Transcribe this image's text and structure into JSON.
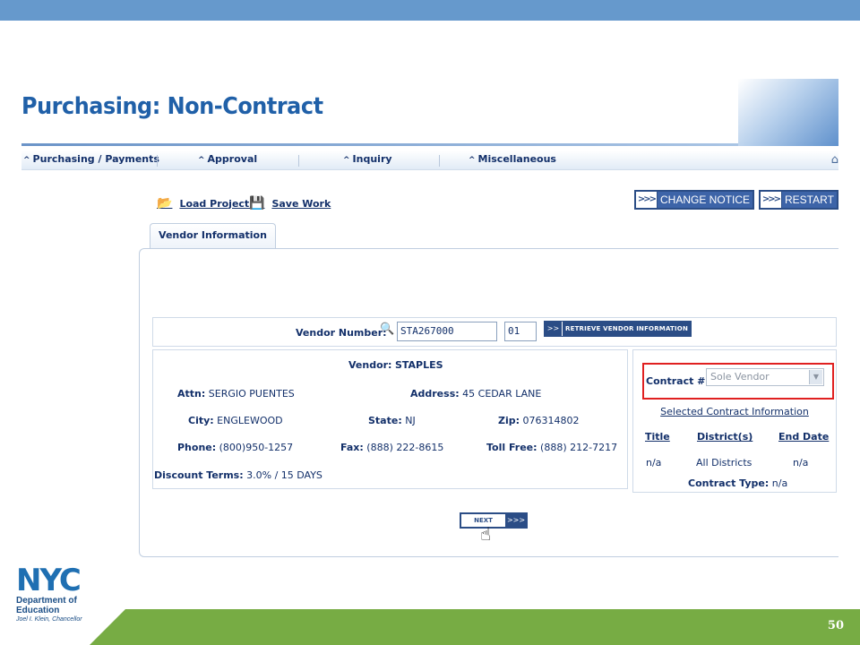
{
  "slide": {
    "title": "Purchasing: Non-Contract",
    "page_number": "50"
  },
  "menu": {
    "items": [
      {
        "label": "Purchasing / Payments"
      },
      {
        "label": "Approval"
      },
      {
        "label": "Inquiry"
      },
      {
        "label": "Miscellaneous"
      }
    ]
  },
  "actions": {
    "load_project": "Load Project",
    "save_work": "Save Work"
  },
  "buttons": {
    "change_notice": "CHANGE NOTICE",
    "restart": "RESTART",
    "retrieve_vendor": "RETRIEVE VENDOR INFORMATION",
    "next": "NEXT"
  },
  "tab": {
    "label": "Vendor Information"
  },
  "vendor_lookup": {
    "label": "Vendor Number:",
    "vendor_number": "STA267000",
    "suffix": "01"
  },
  "vendor": {
    "name_label": "Vendor:",
    "name": "STAPLES",
    "attn_label": "Attn:",
    "attn": "SERGIO PUENTES",
    "address_label": "Address:",
    "address": "45 CEDAR LANE",
    "city_label": "City:",
    "city": "ENGLEWOOD",
    "state_label": "State:",
    "state": "NJ",
    "zip_label": "Zip:",
    "zip": "076314802",
    "phone_label": "Phone:",
    "phone": "(800)950-1257",
    "fax_label": "Fax:",
    "fax": "(888) 222-8615",
    "tollfree_label": "Toll Free:",
    "tollfree": "(888) 212-7217",
    "discount_label": "Discount Terms:",
    "discount": "3.0% / 15 DAYS"
  },
  "contract": {
    "label": "Contract #:",
    "selected": "Sole Vendor",
    "info_link": "Selected Contract Information",
    "headers": {
      "title": "Title",
      "districts": "District(s)",
      "end_date": "End Date"
    },
    "values": {
      "title": "n/a",
      "districts": "All Districts",
      "end_date": "n/a"
    },
    "type_label": "Contract Type:",
    "type_value": "n/a"
  },
  "logo": {
    "wordmark": "NYC",
    "line1": "Department of",
    "line2": "Education",
    "sub": "Joel I. Klein, Chancellor"
  },
  "colors": {
    "title_blue": "#2060a8",
    "top_band": "#6699cc",
    "bottom_band": "#77ac44",
    "highlight": "#e02020"
  }
}
